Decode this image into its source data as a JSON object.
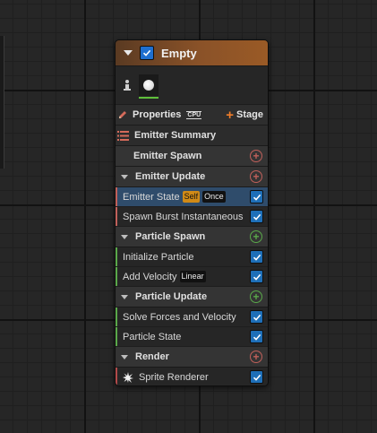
{
  "node": {
    "title": "Empty",
    "properties_label": "Properties",
    "cpu_label": "CPU",
    "stage_label": "Stage",
    "summary_label": "Emitter Summary"
  },
  "sections": {
    "emitter_spawn": "Emitter Spawn",
    "emitter_update": "Emitter Update",
    "particle_spawn": "Particle Spawn",
    "particle_update": "Particle Update",
    "render": "Render"
  },
  "modules": {
    "emitter_state": "Emitter State",
    "emitter_state_badge1": "Self",
    "emitter_state_badge2": "Once",
    "spawn_burst": "Spawn Burst Instantaneous",
    "initialize_particle": "Initialize Particle",
    "add_velocity": "Add Velocity",
    "add_velocity_badge": "Linear",
    "solve_forces": "Solve Forces and Velocity",
    "particle_state": "Particle State",
    "sprite_renderer": "Sprite Renderer"
  },
  "colors": {
    "emitter_stripe": "#c0605a",
    "particle_stripe": "#5aa84a",
    "render_stripe": "#b24a4a",
    "selected_row": "#2f4c6b",
    "checkbox": "#1e6fb8"
  }
}
